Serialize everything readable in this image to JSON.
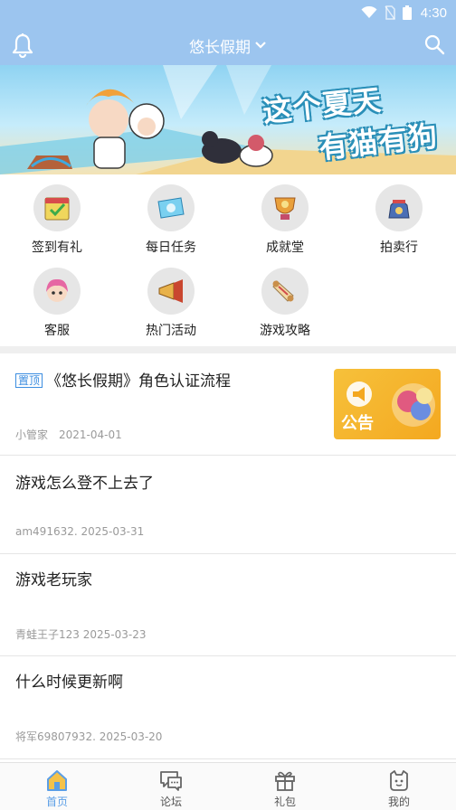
{
  "status_bar": {
    "time": "4:30"
  },
  "header": {
    "title": "悠长假期",
    "bell_icon": "bell-icon",
    "search_icon": "search-icon"
  },
  "banner": {
    "line1": "这个夏天",
    "line2": "有猫有狗"
  },
  "quick_menu": [
    {
      "label": "签到有礼",
      "icon": "checkin-calendar-icon"
    },
    {
      "label": "每日任务",
      "icon": "daily-task-ticket-icon"
    },
    {
      "label": "成就堂",
      "icon": "achievement-trophy-icon"
    },
    {
      "label": "拍卖行",
      "icon": "auction-bag-icon"
    },
    {
      "label": "客服",
      "icon": "customer-service-avatar-icon"
    },
    {
      "label": "热门活动",
      "icon": "trumpet-event-icon"
    },
    {
      "label": "游戏攻略",
      "icon": "scroll-guide-icon"
    }
  ],
  "posts": [
    {
      "pinned_label": "置顶",
      "title": "《悠长假期》角色认证流程",
      "meta": "小管家　2021-04-01",
      "thumb_text": "公告"
    },
    {
      "title": "游戏怎么登不上去了",
      "meta": "am491632. 2025-03-31"
    },
    {
      "title": "游戏老玩家",
      "meta": "青蛙王子123 2025-03-23"
    },
    {
      "title": "什么时候更新啊",
      "meta": "将军69807932. 2025-03-20"
    }
  ],
  "tabbar": [
    {
      "label": "首页",
      "icon": "home-icon",
      "active": true
    },
    {
      "label": "论坛",
      "icon": "forum-chat-icon",
      "active": false
    },
    {
      "label": "礼包",
      "icon": "gift-icon",
      "active": false
    },
    {
      "label": "我的",
      "icon": "profile-icon",
      "active": false
    }
  ],
  "colors": {
    "primary": "#9cc5ef",
    "accent": "#5b9ee6",
    "pin": "#3b8de0",
    "meta": "#9a9a9a"
  }
}
